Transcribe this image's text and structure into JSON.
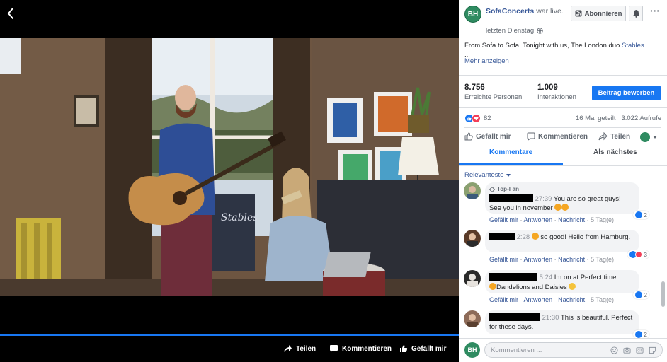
{
  "page": {
    "name": "SofaConcerts",
    "status": "war live.",
    "time": "letzten Dienstag",
    "avatar_initials": "BH"
  },
  "header": {
    "follow_label": "Abonnieren"
  },
  "post": {
    "text": "From Sofa to Sofa: Tonight with us, The London duo ",
    "link_text": "Stables",
    "ellipsis": "...",
    "see_more": "Mehr anzeigen"
  },
  "stats": {
    "reach_value": "8.756",
    "reach_label": "Erreichte Personen",
    "interactions_value": "1.009",
    "interactions_label": "Interaktionen",
    "boost_label": "Beitrag bewerben"
  },
  "reactions": {
    "count": "82",
    "shares": "16 Mal geteilt",
    "views": "3.022 Aufrufe"
  },
  "actions": {
    "like": "Gefällt mir",
    "comment": "Kommentieren",
    "share": "Teilen"
  },
  "tabs": {
    "comments": "Kommentare",
    "up_next": "Als nächstes"
  },
  "sort": {
    "label": "Relevanteste"
  },
  "comments": [
    {
      "badge": "Top-Fan",
      "time": "27:39",
      "text": "You are so great guys! See you in november",
      "actions": [
        "Gefällt mir",
        "Antworten",
        "Nachricht"
      ],
      "age": "5 Tag(e)",
      "reactions": "2"
    },
    {
      "time": "2:28",
      "text": "so good! Hello from Hamburg.",
      "actions": [
        "Gefällt mir",
        "Antworten",
        "Nachricht"
      ],
      "age": "5 Tag(e)",
      "reactions": "3"
    },
    {
      "time": "5:24",
      "text": "Im on at Perfect time",
      "text2": "Dandelions and Daisies",
      "actions": [
        "Gefällt mir",
        "Antworten",
        "Nachricht"
      ],
      "age": "5 Tag(e)",
      "reactions": "2"
    },
    {
      "time": "21:30",
      "text": "This is beautiful. Perfect for these days.",
      "reactions": "2"
    }
  ],
  "composer": {
    "placeholder": "Kommentieren ..."
  },
  "video_controls": {
    "share": "Teilen",
    "comment": "Kommentieren",
    "like": "Gefällt mir",
    "progress": 1.0
  },
  "video": {
    "banner_text": "Stables"
  },
  "colors": {
    "accent": "#1877f2",
    "link": "#385898",
    "brand_green": "#2f8b61"
  }
}
